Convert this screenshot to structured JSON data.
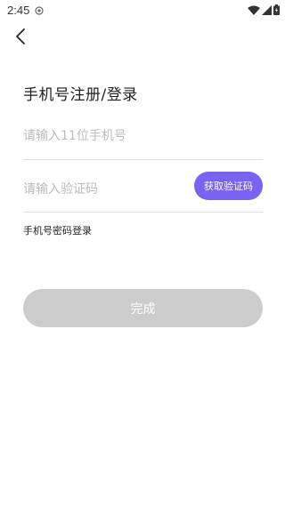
{
  "status_bar": {
    "time": "2:45",
    "icons": [
      "notification-icon",
      "wifi-icon",
      "signal-icon",
      "battery-icon"
    ]
  },
  "nav": {
    "back_icon": "chevron-left-icon"
  },
  "title": "手机号注册/登录",
  "form": {
    "phone_placeholder": "请输入11位手机号",
    "phone_value": "",
    "code_placeholder": "请输入验证码",
    "code_value": "",
    "send_code_label": "获取验证码",
    "password_login_label": "手机号密码登录",
    "submit_label": "完成"
  },
  "colors": {
    "accent": "#7b63f2",
    "submit_disabled": "#cccccc",
    "divider": "#dddddd",
    "placeholder": "#bbbbbb"
  }
}
